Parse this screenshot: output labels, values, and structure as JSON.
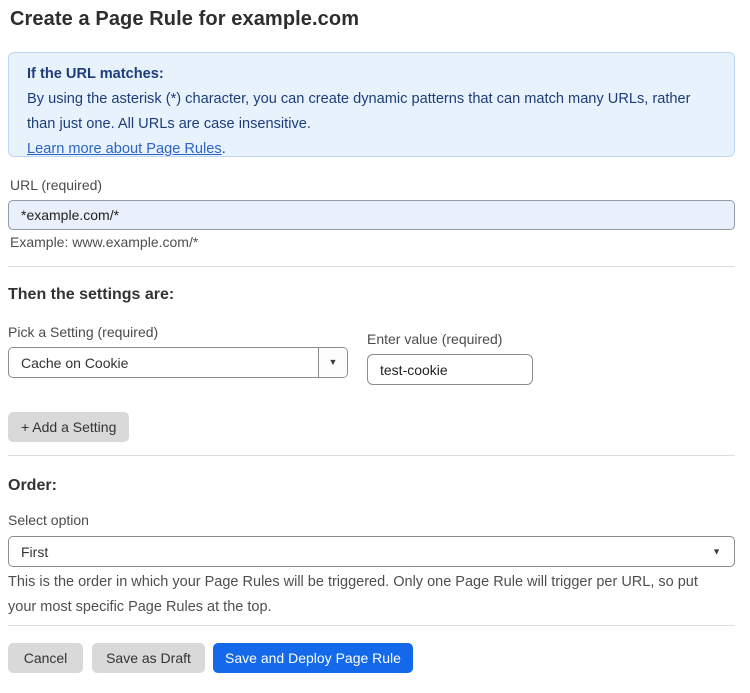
{
  "page": {
    "title": "Create a Page Rule for example.com"
  },
  "info_box": {
    "heading": "If the URL matches:",
    "body": "By using the asterisk (*) character, you can create dynamic patterns that can match many URLs, rather than just one. All URLs are case insensitive.",
    "link_label": "Learn more about Page Rules",
    "link_suffix": "."
  },
  "url_field": {
    "label": "URL (required)",
    "value": "*example.com/*",
    "helper": "Example: www.example.com/*"
  },
  "settings_section": {
    "heading": "Then the settings are:",
    "setting_label": "Pick a Setting (required)",
    "setting_selected": "Cache on Cookie",
    "value_label": "Enter value (required)",
    "value_text": "test-cookie",
    "add_button_label": "+ Add a Setting"
  },
  "order_section": {
    "heading": "Order:",
    "label": "Select option",
    "selected": "First",
    "helper": "This is the order in which your Page Rules will be triggered. Only one Page Rule will trigger per URL, so put your most specific Page Rules at the top."
  },
  "actions": {
    "cancel_label": "Cancel",
    "save_draft_label": "Save as Draft",
    "save_deploy_label": "Save and Deploy Page Rule"
  },
  "icons": {
    "dropdown_arrow": "▼"
  },
  "colors": {
    "accent_blue": "#1369e9",
    "info_bg": "#e8f2fc",
    "info_border": "#bcd8f1",
    "info_text": "#1d3d7a",
    "link_blue": "#2d64c8",
    "url_input_bg": "#e9effb",
    "button_gray": "#d9d9d9"
  }
}
